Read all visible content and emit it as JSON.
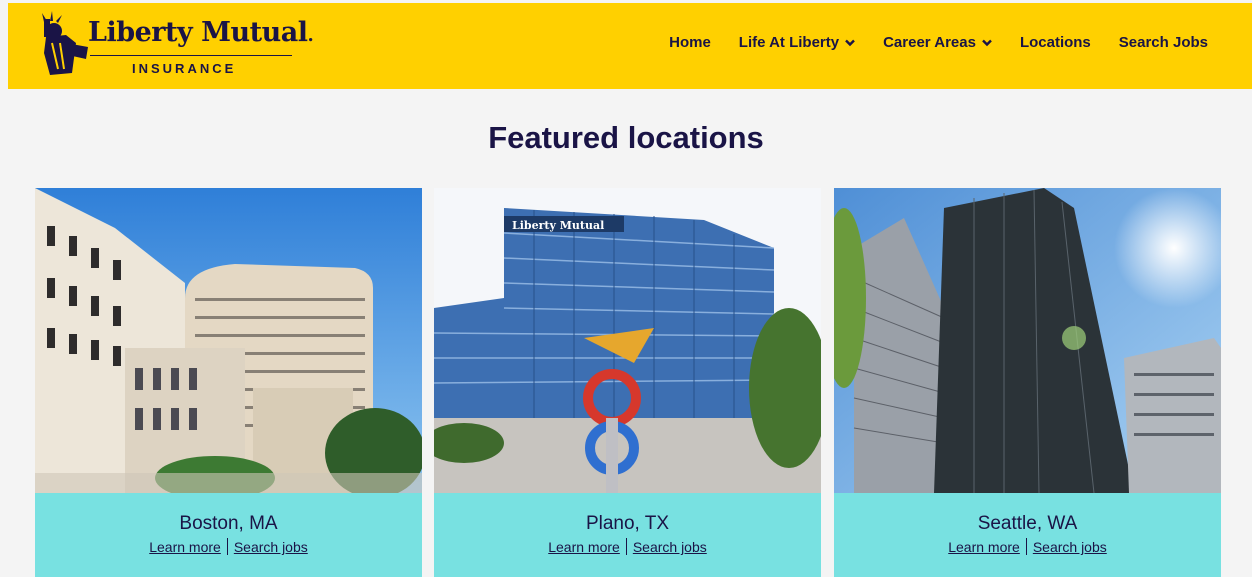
{
  "brand": {
    "name": "Liberty Mutual",
    "sub": "INSURANCE"
  },
  "nav": {
    "home": "Home",
    "life": "Life At Liberty",
    "career": "Career Areas",
    "locations": "Locations",
    "search": "Search Jobs"
  },
  "main": {
    "title": "Featured locations"
  },
  "cards": [
    {
      "city": "Boston, MA",
      "learn": "Learn more",
      "jobs": "Search jobs"
    },
    {
      "city": "Plano, TX",
      "learn": "Learn more",
      "jobs": "Search jobs"
    },
    {
      "city": "Seattle, WA",
      "learn": "Learn more",
      "jobs": "Search jobs"
    }
  ],
  "sign_text": "Liberty Mutual",
  "colors": {
    "brand_yellow": "#ffd000",
    "navy": "#1a1446",
    "teal": "#78e1e1",
    "page_bg": "#f4f4f4"
  },
  "icons": {
    "logo": "statue-of-liberty-icon",
    "dropdown": "chevron-down-icon"
  }
}
